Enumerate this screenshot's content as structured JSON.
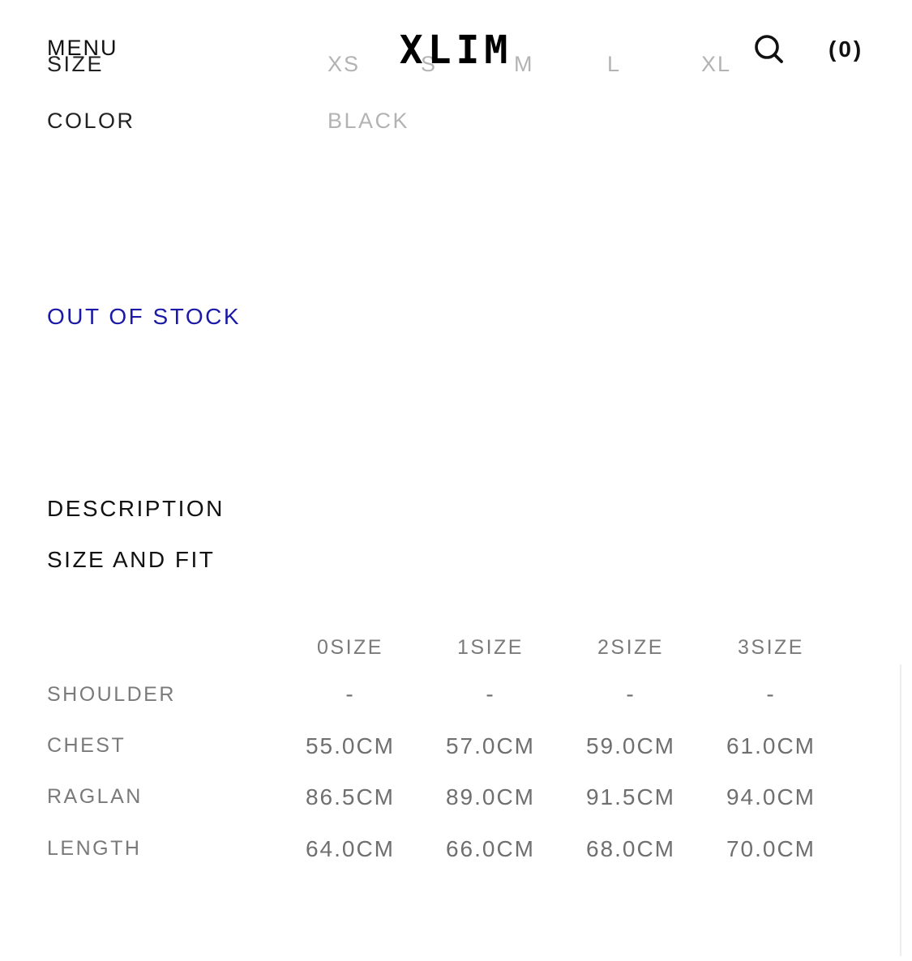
{
  "header": {
    "menu_label": "MENU",
    "logo": "XLIM",
    "search_icon": "search-icon",
    "cart_label": "(0)"
  },
  "options": {
    "size_label": "SIZE",
    "sizes": [
      "XS",
      "S",
      "M",
      "L",
      "XL"
    ],
    "color_label": "COLOR",
    "color_value": "BLACK"
  },
  "stock_status": "OUT OF STOCK",
  "sections": {
    "description": "DESCRIPTION",
    "size_and_fit": "SIZE AND FIT"
  },
  "size_table": {
    "columns": [
      "0SIZE",
      "1SIZE",
      "2SIZE",
      "3SIZE"
    ],
    "rows": [
      {
        "label": "SHOULDER",
        "values": [
          "-",
          "-",
          "-",
          "-"
        ]
      },
      {
        "label": "CHEST",
        "values": [
          "55.0CM",
          "57.0CM",
          "59.0CM",
          "61.0CM"
        ]
      },
      {
        "label": "RAGLAN",
        "values": [
          "86.5CM",
          "89.0CM",
          "91.5CM",
          "94.0CM"
        ]
      },
      {
        "label": "LENGTH",
        "values": [
          "64.0CM",
          "66.0CM",
          "68.0CM",
          "70.0CM"
        ]
      }
    ]
  },
  "colors": {
    "stock_accent": "#1a1aa6",
    "muted_option": "#b3b3b3",
    "table_text": "#6f6f6f"
  }
}
